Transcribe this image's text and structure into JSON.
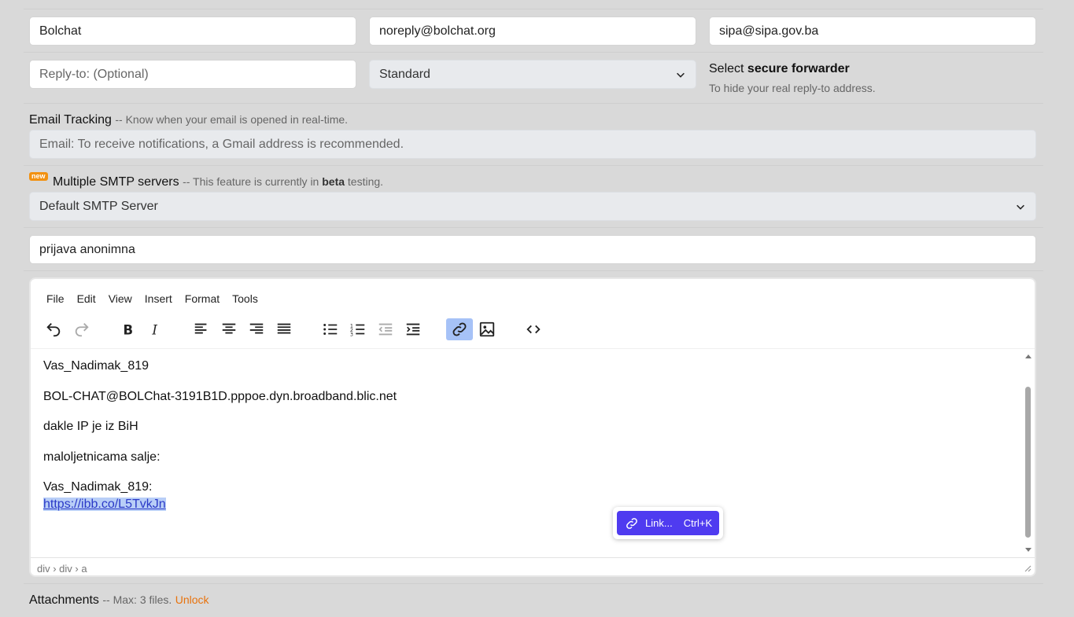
{
  "sender": {
    "name": "Bolchat",
    "from_email": "noreply@bolchat.org",
    "to_email": "sipa@sipa.gov.ba",
    "reply_to_placeholder": "Reply-to: (Optional)",
    "forwarder_select": "Standard",
    "forwarder_label_prefix": "Select ",
    "forwarder_label_bold": "secure forwarder",
    "forwarder_hint": "To hide your real reply-to address."
  },
  "tracking": {
    "label": "Email Tracking",
    "hint": "-- Know when your email is opened in real-time.",
    "placeholder": "Email: To receive notifications, a Gmail address is recommended."
  },
  "smtp": {
    "badge": "new",
    "label": "Multiple SMTP servers",
    "hint_prefix": "-- This feature is currently in ",
    "hint_bold": "beta",
    "hint_suffix": " testing.",
    "selected": "Default SMTP Server"
  },
  "subject": "prijava anonimna",
  "editor": {
    "menu": [
      "File",
      "Edit",
      "View",
      "Insert",
      "Format",
      "Tools"
    ],
    "content": {
      "line1": "Vas_Nadimak_819",
      "line2": "BOL-CHAT@BOLChat-3191B1D.pppoe.dyn.broadband.blic.net",
      "line3": "dakle IP je iz BiH",
      "line4": "maloljetnicama salje:",
      "line5": "Vas_Nadimak_819:",
      "link": "https://ibb.co/L5TvkJn"
    },
    "statusbar": "div › div › a",
    "link_popup": {
      "label": "Link...",
      "shortcut": "Ctrl+K"
    }
  },
  "attachments": {
    "label": "Attachments",
    "hint": "-- Max: 3 files.",
    "unlock": "Unlock"
  },
  "colors": {
    "accent": "#4f3bf0",
    "badge": "#f29111",
    "unlock": "#e8720c",
    "active_tool": "#a6c2f7"
  }
}
